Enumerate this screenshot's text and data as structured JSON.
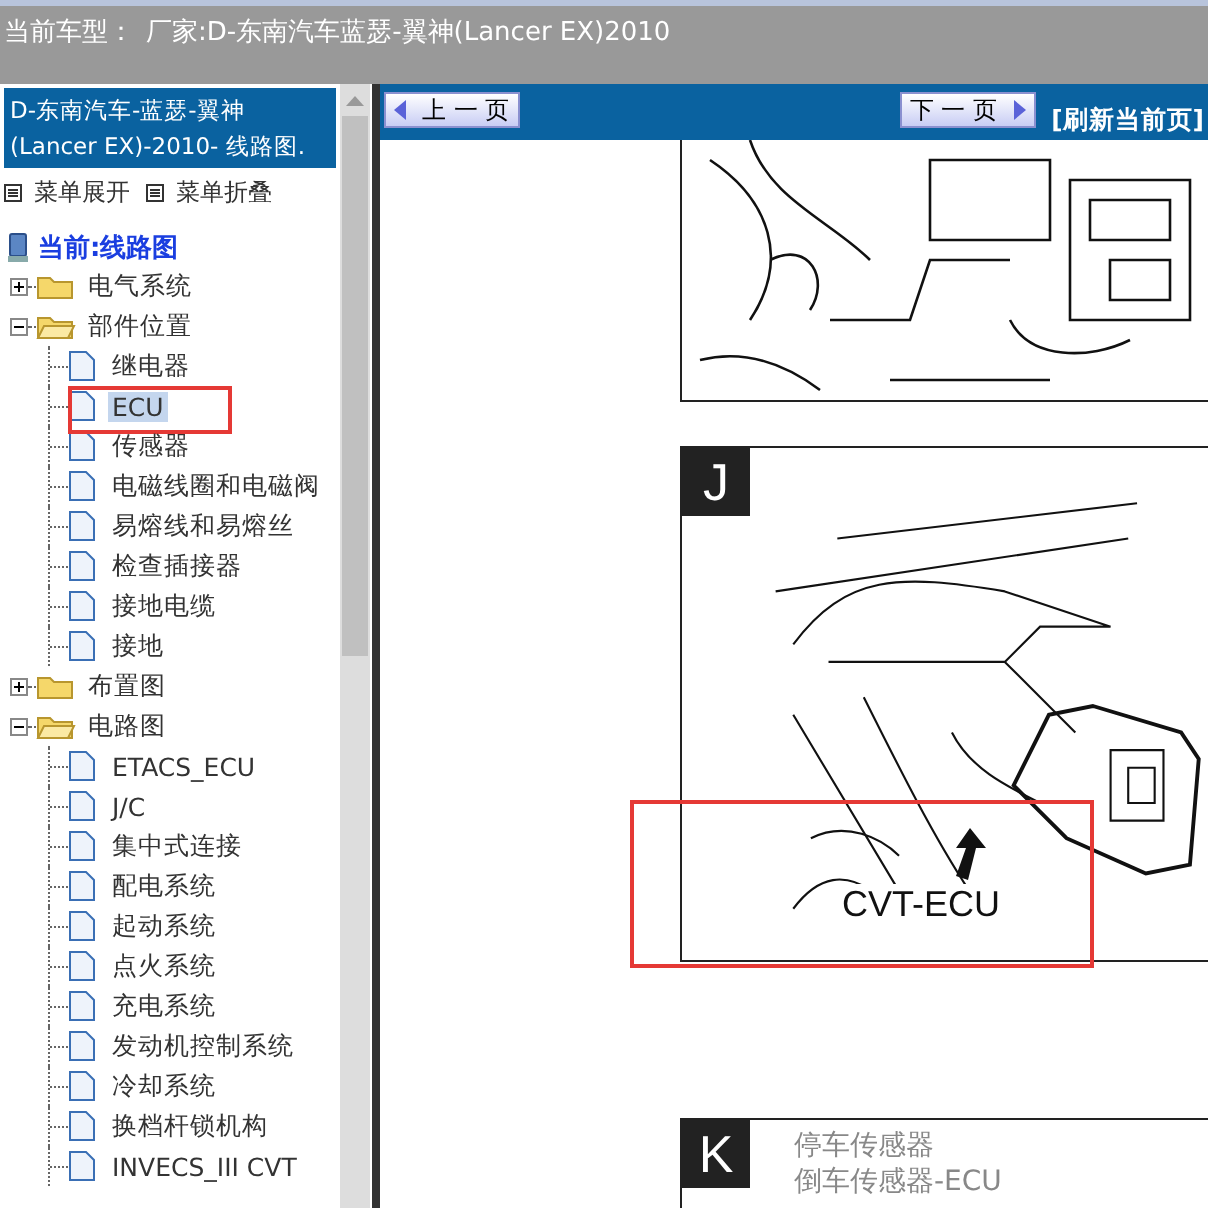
{
  "header": {
    "label": "当前车型：",
    "value": "厂家:D-东南汽车蓝瑟-翼神(Lancer EX)2010"
  },
  "sidebar": {
    "title": "D-东南汽车-蓝瑟-翼神(Lancer EX)-2010- 线路图.",
    "actions": [
      "菜单展开",
      "菜单折叠"
    ],
    "current": "当前:线路图",
    "tree": [
      {
        "label": "电气系统",
        "kind": "folder",
        "expanded": false,
        "selected": false,
        "annotated": false
      },
      {
        "label": "部件位置",
        "kind": "folder",
        "expanded": true,
        "selected": false,
        "annotated": false,
        "children": [
          {
            "label": "继电器",
            "kind": "page",
            "selected": false,
            "annotated": false
          },
          {
            "label": "ECU",
            "kind": "page",
            "selected": true,
            "annotated": true
          },
          {
            "label": "传感器",
            "kind": "page",
            "selected": false,
            "annotated": false
          },
          {
            "label": "电磁线圈和电磁阀",
            "kind": "page",
            "selected": false,
            "annotated": false
          },
          {
            "label": "易熔线和易熔丝",
            "kind": "page",
            "selected": false,
            "annotated": false
          },
          {
            "label": "检查插接器",
            "kind": "page",
            "selected": false,
            "annotated": false
          },
          {
            "label": "接地电缆",
            "kind": "page",
            "selected": false,
            "annotated": false
          },
          {
            "label": "接地",
            "kind": "page",
            "selected": false,
            "annotated": false
          }
        ]
      },
      {
        "label": "布置图",
        "kind": "folder",
        "expanded": false,
        "selected": false,
        "annotated": false
      },
      {
        "label": "电路图",
        "kind": "folder",
        "expanded": true,
        "selected": false,
        "annotated": false,
        "children": [
          {
            "label": "ETACS_ECU",
            "kind": "page",
            "selected": false,
            "annotated": false
          },
          {
            "label": "J/C",
            "kind": "page",
            "selected": false,
            "annotated": false
          },
          {
            "label": "集中式连接",
            "kind": "page",
            "selected": false,
            "annotated": false
          },
          {
            "label": "配电系统",
            "kind": "page",
            "selected": false,
            "annotated": false
          },
          {
            "label": "起动系统",
            "kind": "page",
            "selected": false,
            "annotated": false
          },
          {
            "label": "点火系统",
            "kind": "page",
            "selected": false,
            "annotated": false
          },
          {
            "label": "充电系统",
            "kind": "page",
            "selected": false,
            "annotated": false
          },
          {
            "label": "发动机控制系统",
            "kind": "page",
            "selected": false,
            "annotated": false
          },
          {
            "label": "冷却系统",
            "kind": "page",
            "selected": false,
            "annotated": false
          },
          {
            "label": "换档杆锁机构",
            "kind": "page",
            "selected": false,
            "annotated": false
          },
          {
            "label": "INVECS_III CVT",
            "kind": "page",
            "selected": false,
            "annotated": false
          }
        ]
      }
    ]
  },
  "toolbar": {
    "prev": "上 一 页",
    "next": "下 一 页",
    "refresh": "[刷新当前页]"
  },
  "figures": [
    {
      "kind": "top"
    },
    {
      "kind": "ecu",
      "letter": "J",
      "callout": "CVT-ECU",
      "annotated": true
    },
    {
      "kind": "sensor",
      "letter": "K",
      "labels": [
        "停车传感器",
        "倒车传感器-ECU"
      ]
    }
  ]
}
